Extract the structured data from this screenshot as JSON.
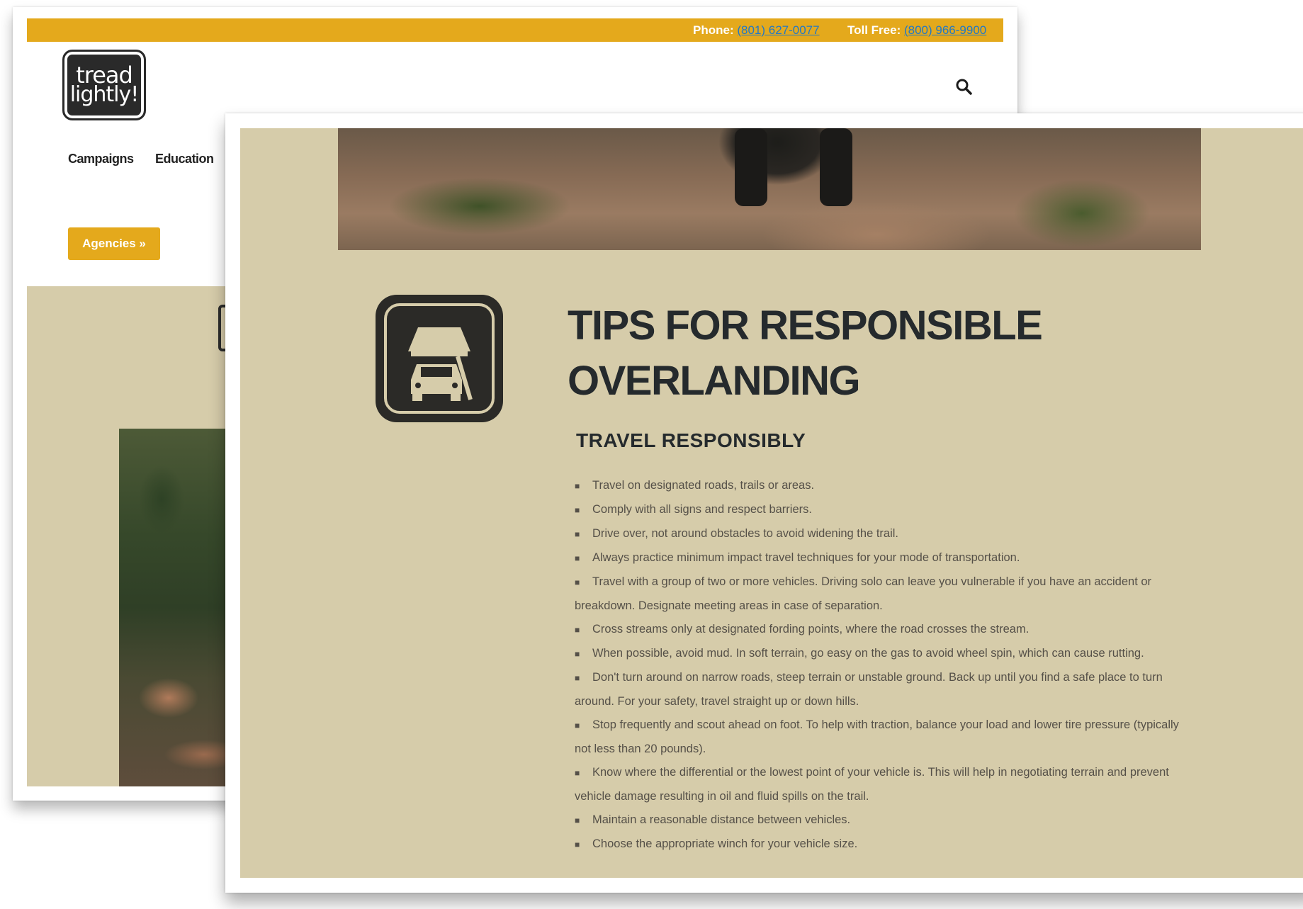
{
  "back_window": {
    "topbar": {
      "phone_label": "Phone:",
      "phone_number": "(801) 627-0077",
      "tollfree_label": "Toll Free:",
      "tollfree_number": "(800) 966-9900"
    },
    "logo": {
      "line1": "tread",
      "line2": "lightly!"
    },
    "nav": {
      "items": [
        "Campaigns",
        "Education"
      ]
    },
    "agencies_button": "Agencies »"
  },
  "front_window": {
    "title_line1": "TIPS FOR RESPONSIBLE",
    "title_line2": "OVERLANDING",
    "subtitle": "TRAVEL RESPONSIBLY",
    "tips": [
      "Travel on designated roads, trails or areas.",
      "Comply with all signs and respect barriers.",
      "Drive over, not around obstacles to avoid widening the trail.",
      "Always practice minimum impact travel techniques for your mode of transportation.",
      "Travel with a group of two or more vehicles. Driving solo can leave you vulnerable if you have an accident or breakdown. Designate meeting areas in case of separation.",
      "Cross streams only at designated fording points, where the road crosses the stream.",
      "When possible, avoid mud. In soft terrain, go easy on the gas to avoid wheel spin, which can cause rutting.",
      "Don't turn around on narrow roads, steep terrain or unstable ground. Back up until you find a safe place to turn around. For your safety, travel straight up or down hills.",
      "Stop frequently and scout ahead on foot. To help with traction, balance your load and lower tire pressure (typically not less than 20 pounds).",
      "Know where the differential or the lowest point of your vehicle is. This will help in negotiating terrain and prevent vehicle damage resulting in oil and fluid spills on the trail.",
      "Maintain a reasonable distance between vehicles.",
      "Choose the appropriate winch for your vehicle size."
    ]
  },
  "colors": {
    "accent_yellow": "#e4a91c",
    "tan_background": "#d6ccaa",
    "heading_dark": "#252a2d",
    "link_blue": "#1f78c8"
  }
}
